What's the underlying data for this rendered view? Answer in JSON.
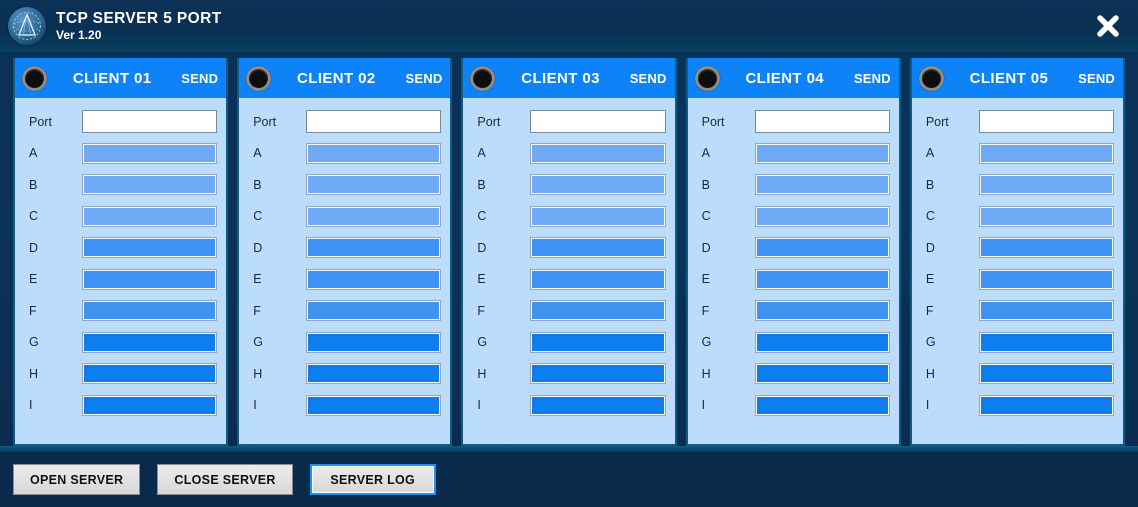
{
  "window": {
    "title": "TCP SERVER 5 PORT",
    "version": "Ver 1.20",
    "logo_icon": "triangle-globe-icon",
    "close_icon": "close-icon",
    "accent_color": "#0d83f7",
    "titlebar_color": "#0a3057",
    "panel_bg_color": "#bcdcfb",
    "panel_border_color": "#0e5c86"
  },
  "clients": [
    {
      "name": "CLIENT 01",
      "send_label": "SEND",
      "led_icon": "status-led-icon",
      "led_state": "off",
      "rows": [
        {
          "label": "Port",
          "value": "",
          "style": "white"
        },
        {
          "label": "A",
          "value": "",
          "style": "light"
        },
        {
          "label": "B",
          "value": "",
          "style": "light"
        },
        {
          "label": "C",
          "value": "",
          "style": "light"
        },
        {
          "label": "D",
          "value": "",
          "style": "medium"
        },
        {
          "label": "E",
          "value": "",
          "style": "medium"
        },
        {
          "label": "F",
          "value": "",
          "style": "medium"
        },
        {
          "label": "G",
          "value": "",
          "style": "bright"
        },
        {
          "label": "H",
          "value": "",
          "style": "bright"
        },
        {
          "label": "I",
          "value": "",
          "style": "bright"
        }
      ]
    },
    {
      "name": "CLIENT 02",
      "send_label": "SEND",
      "led_icon": "status-led-icon",
      "led_state": "off",
      "rows": [
        {
          "label": "Port",
          "value": "",
          "style": "white"
        },
        {
          "label": "A",
          "value": "",
          "style": "light"
        },
        {
          "label": "B",
          "value": "",
          "style": "light"
        },
        {
          "label": "C",
          "value": "",
          "style": "light"
        },
        {
          "label": "D",
          "value": "",
          "style": "medium"
        },
        {
          "label": "E",
          "value": "",
          "style": "medium"
        },
        {
          "label": "F",
          "value": "",
          "style": "medium"
        },
        {
          "label": "G",
          "value": "",
          "style": "bright"
        },
        {
          "label": "H",
          "value": "",
          "style": "bright"
        },
        {
          "label": "I",
          "value": "",
          "style": "bright"
        }
      ]
    },
    {
      "name": "CLIENT 03",
      "send_label": "SEND",
      "led_icon": "status-led-icon",
      "led_state": "off",
      "rows": [
        {
          "label": "Port",
          "value": "",
          "style": "white"
        },
        {
          "label": "A",
          "value": "",
          "style": "light"
        },
        {
          "label": "B",
          "value": "",
          "style": "light"
        },
        {
          "label": "C",
          "value": "",
          "style": "light"
        },
        {
          "label": "D",
          "value": "",
          "style": "medium"
        },
        {
          "label": "E",
          "value": "",
          "style": "medium"
        },
        {
          "label": "F",
          "value": "",
          "style": "medium"
        },
        {
          "label": "G",
          "value": "",
          "style": "bright"
        },
        {
          "label": "H",
          "value": "",
          "style": "bright"
        },
        {
          "label": "I",
          "value": "",
          "style": "bright"
        }
      ]
    },
    {
      "name": "CLIENT 04",
      "send_label": "SEND",
      "led_icon": "status-led-icon",
      "led_state": "off",
      "rows": [
        {
          "label": "Port",
          "value": "",
          "style": "white"
        },
        {
          "label": "A",
          "value": "",
          "style": "light"
        },
        {
          "label": "B",
          "value": "",
          "style": "light"
        },
        {
          "label": "C",
          "value": "",
          "style": "light"
        },
        {
          "label": "D",
          "value": "",
          "style": "medium"
        },
        {
          "label": "E",
          "value": "",
          "style": "medium"
        },
        {
          "label": "F",
          "value": "",
          "style": "medium"
        },
        {
          "label": "G",
          "value": "",
          "style": "bright"
        },
        {
          "label": "H",
          "value": "",
          "style": "bright"
        },
        {
          "label": "I",
          "value": "",
          "style": "bright"
        }
      ]
    },
    {
      "name": "CLIENT 05",
      "send_label": "SEND",
      "led_icon": "status-led-icon",
      "led_state": "off",
      "rows": [
        {
          "label": "Port",
          "value": "",
          "style": "white"
        },
        {
          "label": "A",
          "value": "",
          "style": "light"
        },
        {
          "label": "B",
          "value": "",
          "style": "light"
        },
        {
          "label": "C",
          "value": "",
          "style": "light"
        },
        {
          "label": "D",
          "value": "",
          "style": "medium"
        },
        {
          "label": "E",
          "value": "",
          "style": "medium"
        },
        {
          "label": "F",
          "value": "",
          "style": "medium"
        },
        {
          "label": "G",
          "value": "",
          "style": "bright"
        },
        {
          "label": "H",
          "value": "",
          "style": "bright"
        },
        {
          "label": "I",
          "value": "",
          "style": "bright"
        }
      ]
    }
  ],
  "field_styles": {
    "white": "#ffffff",
    "light": "#6fabf5",
    "medium": "#3e93f3",
    "bright": "#0d7ef0"
  },
  "footer": {
    "buttons": [
      {
        "label": "OPEN SERVER",
        "focused": false
      },
      {
        "label": "CLOSE SERVER",
        "focused": false
      },
      {
        "label": "SERVER LOG",
        "focused": true
      }
    ]
  }
}
